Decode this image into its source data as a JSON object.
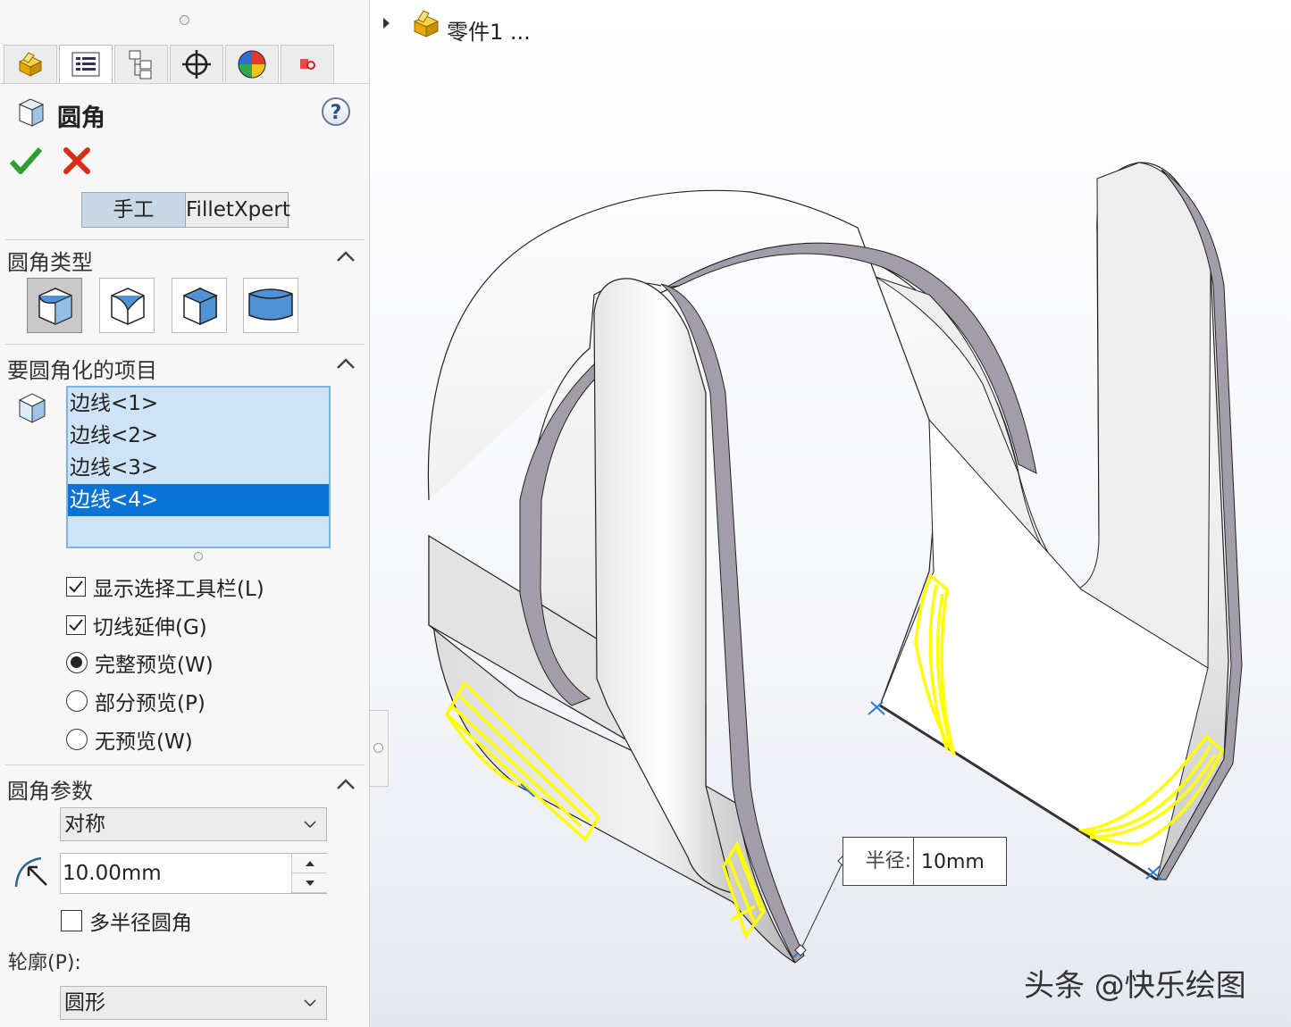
{
  "property_manager": {
    "tabs": [
      {
        "icon": "part-icon"
      },
      {
        "icon": "property-manager-icon"
      },
      {
        "icon": "configuration-manager-icon"
      },
      {
        "icon": "dimxpert-icon"
      },
      {
        "icon": "display-manager-icon"
      },
      {
        "icon": "cam-icon"
      }
    ],
    "title": "圆角",
    "help": "?",
    "mode_buttons": {
      "manual": "手工",
      "expert": "FilletXpert"
    },
    "fillet_type": {
      "header": "圆角类型",
      "options": [
        "constant-size-fillet-icon",
        "variable-size-fillet-icon",
        "face-fillet-icon",
        "full-round-fillet-icon"
      ],
      "selected_index": 0
    },
    "items_to_fillet": {
      "header": "要圆角化的项目",
      "edges": [
        "边线<1>",
        "边线<2>",
        "边线<3>",
        "边线<4>"
      ],
      "selected_index": 3
    },
    "options": {
      "show_selection_toolbar": {
        "label": "显示选择工具栏(L)",
        "checked": true
      },
      "tangent_propagation": {
        "label": "切线延伸(G)",
        "checked": true
      },
      "full_preview": {
        "label": "完整预览(W)",
        "selected": true
      },
      "partial_preview": {
        "label": "部分预览(P)",
        "selected": false
      },
      "no_preview": {
        "label": "无预览(W)",
        "selected": false
      }
    },
    "fillet_parameters": {
      "header": "圆角参数",
      "method": "对称",
      "radius": "10.00mm",
      "multiple_radius": {
        "label": "多半径圆角",
        "checked": false
      },
      "profile_label": "轮廓(P):",
      "profile": "圆形"
    }
  },
  "graphics": {
    "tree_label": "零件1 ...",
    "callout": {
      "label": "半径:",
      "value": "10mm"
    },
    "watermark": "头条 @快乐绘图",
    "colors": {
      "highlight": "#ffff00",
      "edge_face": "#a39ca9",
      "selection_blue": "#0a73d8"
    }
  }
}
